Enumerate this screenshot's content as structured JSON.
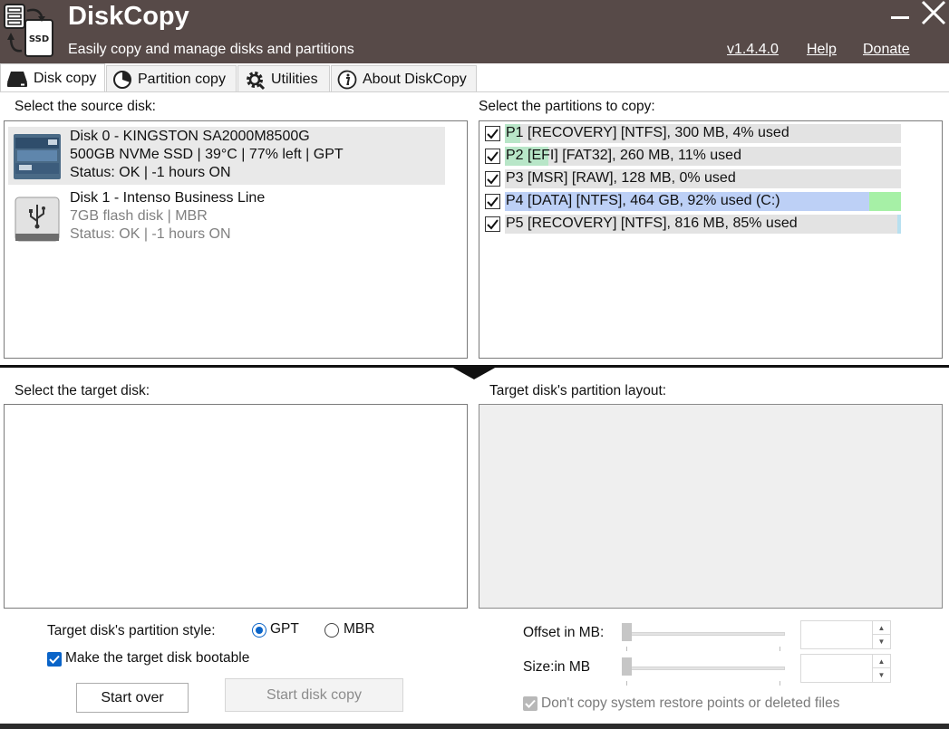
{
  "app": {
    "title": "DiskCopy",
    "subtitle": "Easily copy and manage disks and partitions",
    "version": "v1.4.4.0",
    "help": "Help",
    "donate": "Donate"
  },
  "tabs": [
    {
      "label": "Disk copy",
      "icon": "disk-icon",
      "active": true
    },
    {
      "label": "Partition copy",
      "icon": "pie-icon",
      "active": false
    },
    {
      "label": "Utilities",
      "icon": "gear-icon",
      "active": false
    },
    {
      "label": "About DiskCopy",
      "icon": "info-icon",
      "active": false
    }
  ],
  "source": {
    "label": "Select the source disk:",
    "disks": [
      {
        "name": "Disk 0 - KINGSTON SA2000M8500G",
        "details": "500GB NVMe SSD | 39°C | 77% left | GPT",
        "status": "Status: OK | -1 hours ON",
        "icon": "nvme-ssd-icon",
        "selected": true
      },
      {
        "name": "Disk 1 - Intenso Business Line",
        "details": "7GB flash disk | MBR",
        "status": "Status: OK | -1 hours ON",
        "icon": "usb-drive-icon",
        "selected": false
      }
    ]
  },
  "partitions": {
    "label": "Select the partitions to copy:",
    "items": [
      {
        "text": "P1 [RECOVERY] [NTFS], 300 MB, 4% used",
        "used": 0.04,
        "checked": true,
        "color": "#b8e6c8"
      },
      {
        "text": "P2 [EFI] [FAT32], 260 MB, 11% used",
        "used": 0.11,
        "checked": true,
        "color": "#b8e6c8"
      },
      {
        "text": "P3 [MSR] [RAW], 128 MB, 0% used",
        "used": 0.0,
        "checked": true,
        "color": "#b8e6c8"
      },
      {
        "text": "P4 [DATA] [NTFS], 464 GB, 92% used (C:)",
        "used": 0.92,
        "checked": true,
        "color": "#bdd0f6",
        "free_color": "#a6f0a6"
      },
      {
        "text": "P5 [RECOVERY] [NTFS], 816 MB, 85% used",
        "used": 0.85,
        "checked": true,
        "color": "#e3e3e3",
        "free_color": "#b8e0f0"
      }
    ]
  },
  "target": {
    "label": "Select the target disk:",
    "layout_label": "Target disk's partition layout:"
  },
  "options": {
    "style_label": "Target disk's partition style:",
    "gpt": "GPT",
    "mbr": "MBR",
    "selected_style": "GPT",
    "bootable_label": "Make the target disk bootable",
    "bootable": true,
    "offset_label": "Offset in MB:",
    "size_label": "Size:in MB",
    "restore_label": "Don't copy system restore points or deleted files"
  },
  "buttons": {
    "start_over": "Start over",
    "start_copy": "Start disk copy"
  },
  "colors": {
    "titlebar": "#574a48",
    "accent": "#0a64c8"
  }
}
